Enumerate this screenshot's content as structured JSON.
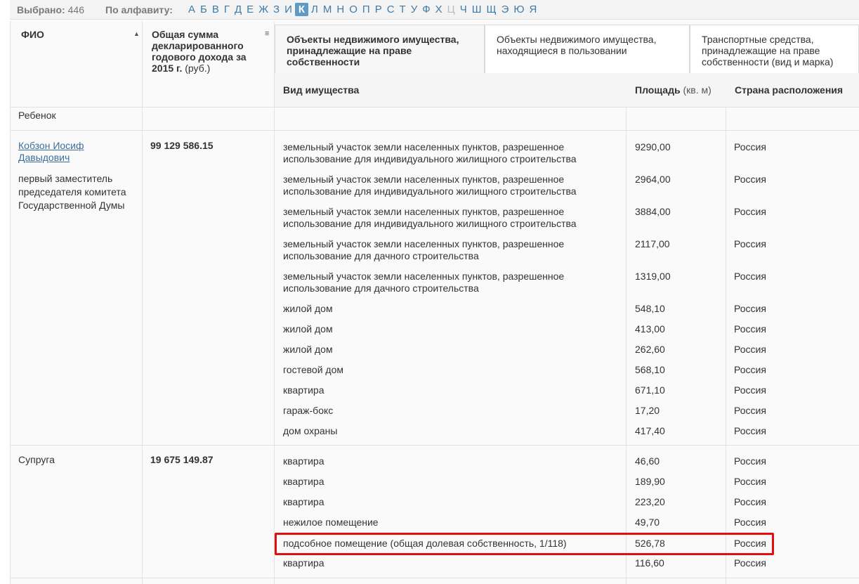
{
  "topbar": {
    "selected_label": "Выбрано:",
    "selected_count": "446",
    "alphabet_label": "По алфавиту:",
    "letters": [
      "А",
      "Б",
      "В",
      "Г",
      "Д",
      "Е",
      "Ж",
      "З",
      "И",
      "К",
      "Л",
      "М",
      "Н",
      "О",
      "П",
      "Р",
      "С",
      "Т",
      "У",
      "Ф",
      "Х",
      "Ц",
      "Ч",
      "Ш",
      "Щ",
      "Э",
      "Ю",
      "Я"
    ],
    "active_letter": "К",
    "disabled_letters": [
      "Ц"
    ]
  },
  "table": {
    "col_fio": "ФИО",
    "col_income": "Общая сумма декларированного годового дохода за",
    "col_income_year": "2015 г.",
    "col_income_unit": "(руб.)",
    "tabs": [
      "Объекты недвижимого имущества, принадлежащие на праве собственности",
      "Объекты недвижимого имущества, находящиеся в пользовании",
      "Транспортные средства, принадлежащие на праве собственности (вид и марка)"
    ],
    "sub_type": "Вид имущества",
    "sub_area": "Площадь",
    "sub_area_unit": "(кв. м)",
    "sub_country": "Страна расположения"
  },
  "rows": {
    "child_label": "Ребенок",
    "person": {
      "name": "Кобзон Иосиф Давыдович",
      "position": "первый заместитель председателя комитета Государственной Думы",
      "income": "99 129 586.15",
      "properties": [
        {
          "type": "земельный участок земли населенных пунктов, разрешенное использование для индивидуального жилищного строительства",
          "area": "9290,00",
          "country": "Россия"
        },
        {
          "type": "земельный участок земли населенных пунктов, разрешенное использование для индивидуального жилищного строительства",
          "area": "2964,00",
          "country": "Россия"
        },
        {
          "type": "земельный участок земли населенных пунктов, разрешенное использование для индивидуального жилищного строительства",
          "area": "3884,00",
          "country": "Россия"
        },
        {
          "type": "земельный участок земли населенных пунктов, разрешенное использование для дачного строительства",
          "area": "2117,00",
          "country": "Россия"
        },
        {
          "type": "земельный участок земли населенных пунктов, разрешенное использование для дачного строительства",
          "area": "1319,00",
          "country": "Россия"
        },
        {
          "type": "жилой дом",
          "area": "548,10",
          "country": "Россия"
        },
        {
          "type": "жилой дом",
          "area": "413,00",
          "country": "Россия"
        },
        {
          "type": "жилой дом",
          "area": "262,60",
          "country": "Россия"
        },
        {
          "type": "гостевой дом",
          "area": "568,10",
          "country": "Россия"
        },
        {
          "type": "квартира",
          "area": "671,10",
          "country": "Россия"
        },
        {
          "type": "гараж-бокс",
          "area": "17,20",
          "country": "Россия"
        },
        {
          "type": "дом охраны",
          "area": "417,40",
          "country": "Россия"
        }
      ]
    },
    "spouse": {
      "label": "Супруга",
      "income": "19 675 149.87",
      "properties": [
        {
          "type": "квартира",
          "area": "46,60",
          "country": "Россия"
        },
        {
          "type": "квартира",
          "area": "189,90",
          "country": "Россия"
        },
        {
          "type": "квартира",
          "area": "223,20",
          "country": "Россия"
        },
        {
          "type": "нежилое помещение",
          "area": "49,70",
          "country": "Россия"
        },
        {
          "type": "подсобное помещение (общая долевая собственность, 1/118)",
          "area": "526,78",
          "country": "Россия"
        },
        {
          "type": "квартира",
          "area": "116,60",
          "country": "Россия"
        }
      ]
    }
  },
  "colors": {
    "highlight": "#e01010",
    "link": "#3d6e9a",
    "active_letter_bg": "#5d9bc6"
  }
}
